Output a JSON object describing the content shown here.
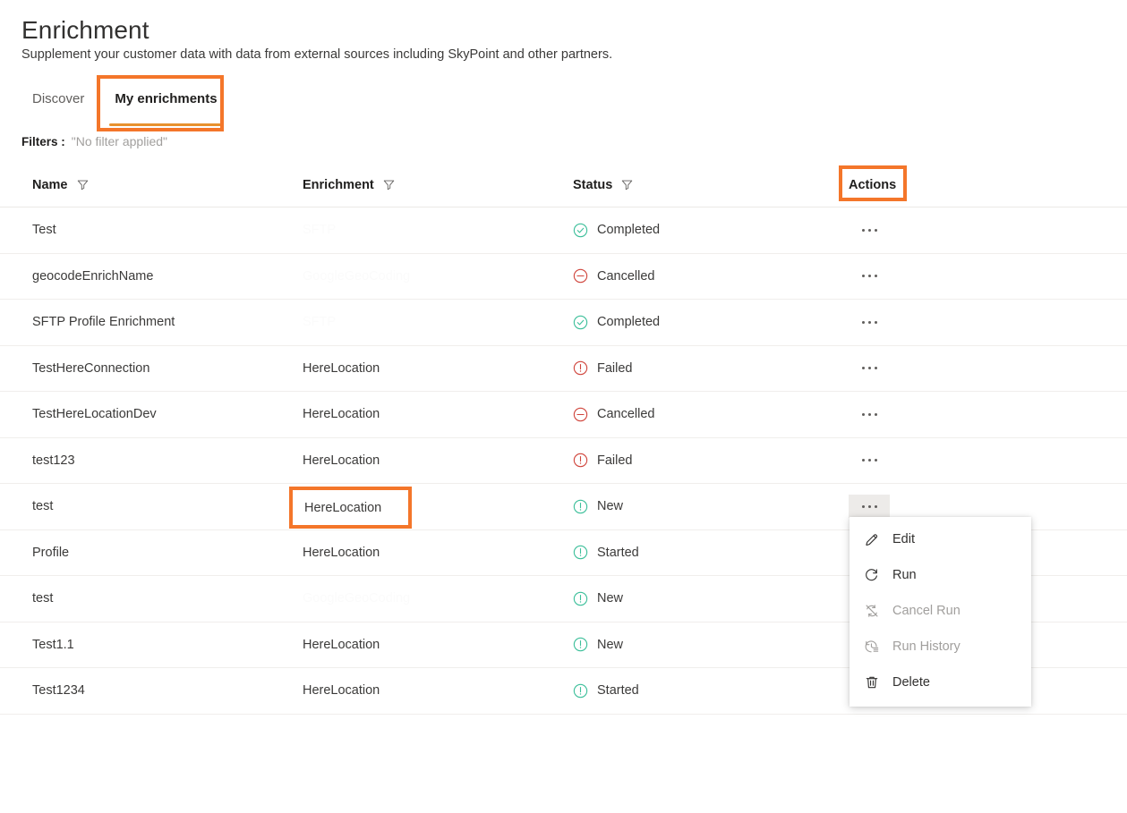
{
  "header": {
    "title": "Enrichment",
    "subtitle": "Supplement your customer data with data from external sources including SkyPoint and other partners."
  },
  "tabs": [
    {
      "label": "Discover",
      "active": false
    },
    {
      "label": "My enrichments",
      "active": true
    }
  ],
  "filters": {
    "label": "Filters :",
    "value": "\"No filter applied\""
  },
  "table": {
    "columns": [
      {
        "label": "Name",
        "filter_icon": "filter-icon"
      },
      {
        "label": "Enrichment",
        "filter_icon": "filter-icon"
      },
      {
        "label": "Status",
        "filter_icon": "filter-icon"
      },
      {
        "label": "Actions",
        "filter_icon": null
      }
    ],
    "rows": [
      {
        "name": "Test",
        "enrichment": "SFTP",
        "enrichment_faded": true,
        "status": "Completed",
        "status_icon": "check-circle-icon",
        "status_color": "#3cbf9a",
        "actions_open": false
      },
      {
        "name": "geocodeEnrichName",
        "enrichment": "GoogleGeoCoding",
        "enrichment_faded": true,
        "status": "Cancelled",
        "status_icon": "minus-circle-icon",
        "status_color": "#d0453c",
        "actions_open": false
      },
      {
        "name": "SFTP Profile Enrichment",
        "enrichment": "SFTP",
        "enrichment_faded": true,
        "status": "Completed",
        "status_icon": "check-circle-icon",
        "status_color": "#3cbf9a",
        "actions_open": false
      },
      {
        "name": "TestHereConnection",
        "enrichment": "HereLocation",
        "enrichment_faded": false,
        "status": "Failed",
        "status_icon": "exclamation-circle-icon",
        "status_color": "#d0453c",
        "actions_open": false
      },
      {
        "name": "TestHereLocationDev",
        "enrichment": "HereLocation",
        "enrichment_faded": false,
        "status": "Cancelled",
        "status_icon": "minus-circle-icon",
        "status_color": "#d0453c",
        "actions_open": false
      },
      {
        "name": "test123",
        "enrichment": "HereLocation",
        "enrichment_faded": false,
        "status": "Failed",
        "status_icon": "exclamation-circle-icon",
        "status_color": "#d0453c",
        "actions_open": false
      },
      {
        "name": "test",
        "enrichment": "HereLocation",
        "enrichment_faded": false,
        "status": "New",
        "status_icon": "exclamation-circle-icon",
        "status_color": "#3cbf9a",
        "actions_open": true
      },
      {
        "name": "Profile",
        "enrichment": "HereLocation",
        "enrichment_faded": false,
        "status": "Started",
        "status_icon": "exclamation-circle-icon",
        "status_color": "#3cbf9a",
        "actions_open": false
      },
      {
        "name": "test",
        "enrichment": "GoogleGeoCoding",
        "enrichment_faded": true,
        "status": "New",
        "status_icon": "exclamation-circle-icon",
        "status_color": "#3cbf9a",
        "actions_open": false
      },
      {
        "name": "Test1.1",
        "enrichment": "HereLocation",
        "enrichment_faded": false,
        "status": "New",
        "status_icon": "exclamation-circle-icon",
        "status_color": "#3cbf9a",
        "actions_open": false
      },
      {
        "name": "Test1234",
        "enrichment": "HereLocation",
        "enrichment_faded": false,
        "status": "Started",
        "status_icon": "exclamation-circle-icon",
        "status_color": "#3cbf9a",
        "actions_open": false
      }
    ]
  },
  "context_menu": {
    "items": [
      {
        "label": "Edit",
        "icon": "pencil-icon",
        "disabled": false
      },
      {
        "label": "Run",
        "icon": "refresh-icon",
        "disabled": false
      },
      {
        "label": "Cancel Run",
        "icon": "cancel-sync-icon",
        "disabled": true
      },
      {
        "label": "Run History",
        "icon": "history-icon",
        "disabled": true
      },
      {
        "label": "Delete",
        "icon": "trash-icon",
        "disabled": false
      }
    ]
  },
  "highlights": {
    "color": "#F4762A",
    "targets": [
      "my-enrichments-tab",
      "actions-column-header",
      "herelocation-cell-row7"
    ]
  },
  "highlighted_cell_value": "HereLocation",
  "accent": {
    "tab_underline": "#E8912E",
    "success": "#3cbf9a",
    "error": "#d0453c"
  }
}
